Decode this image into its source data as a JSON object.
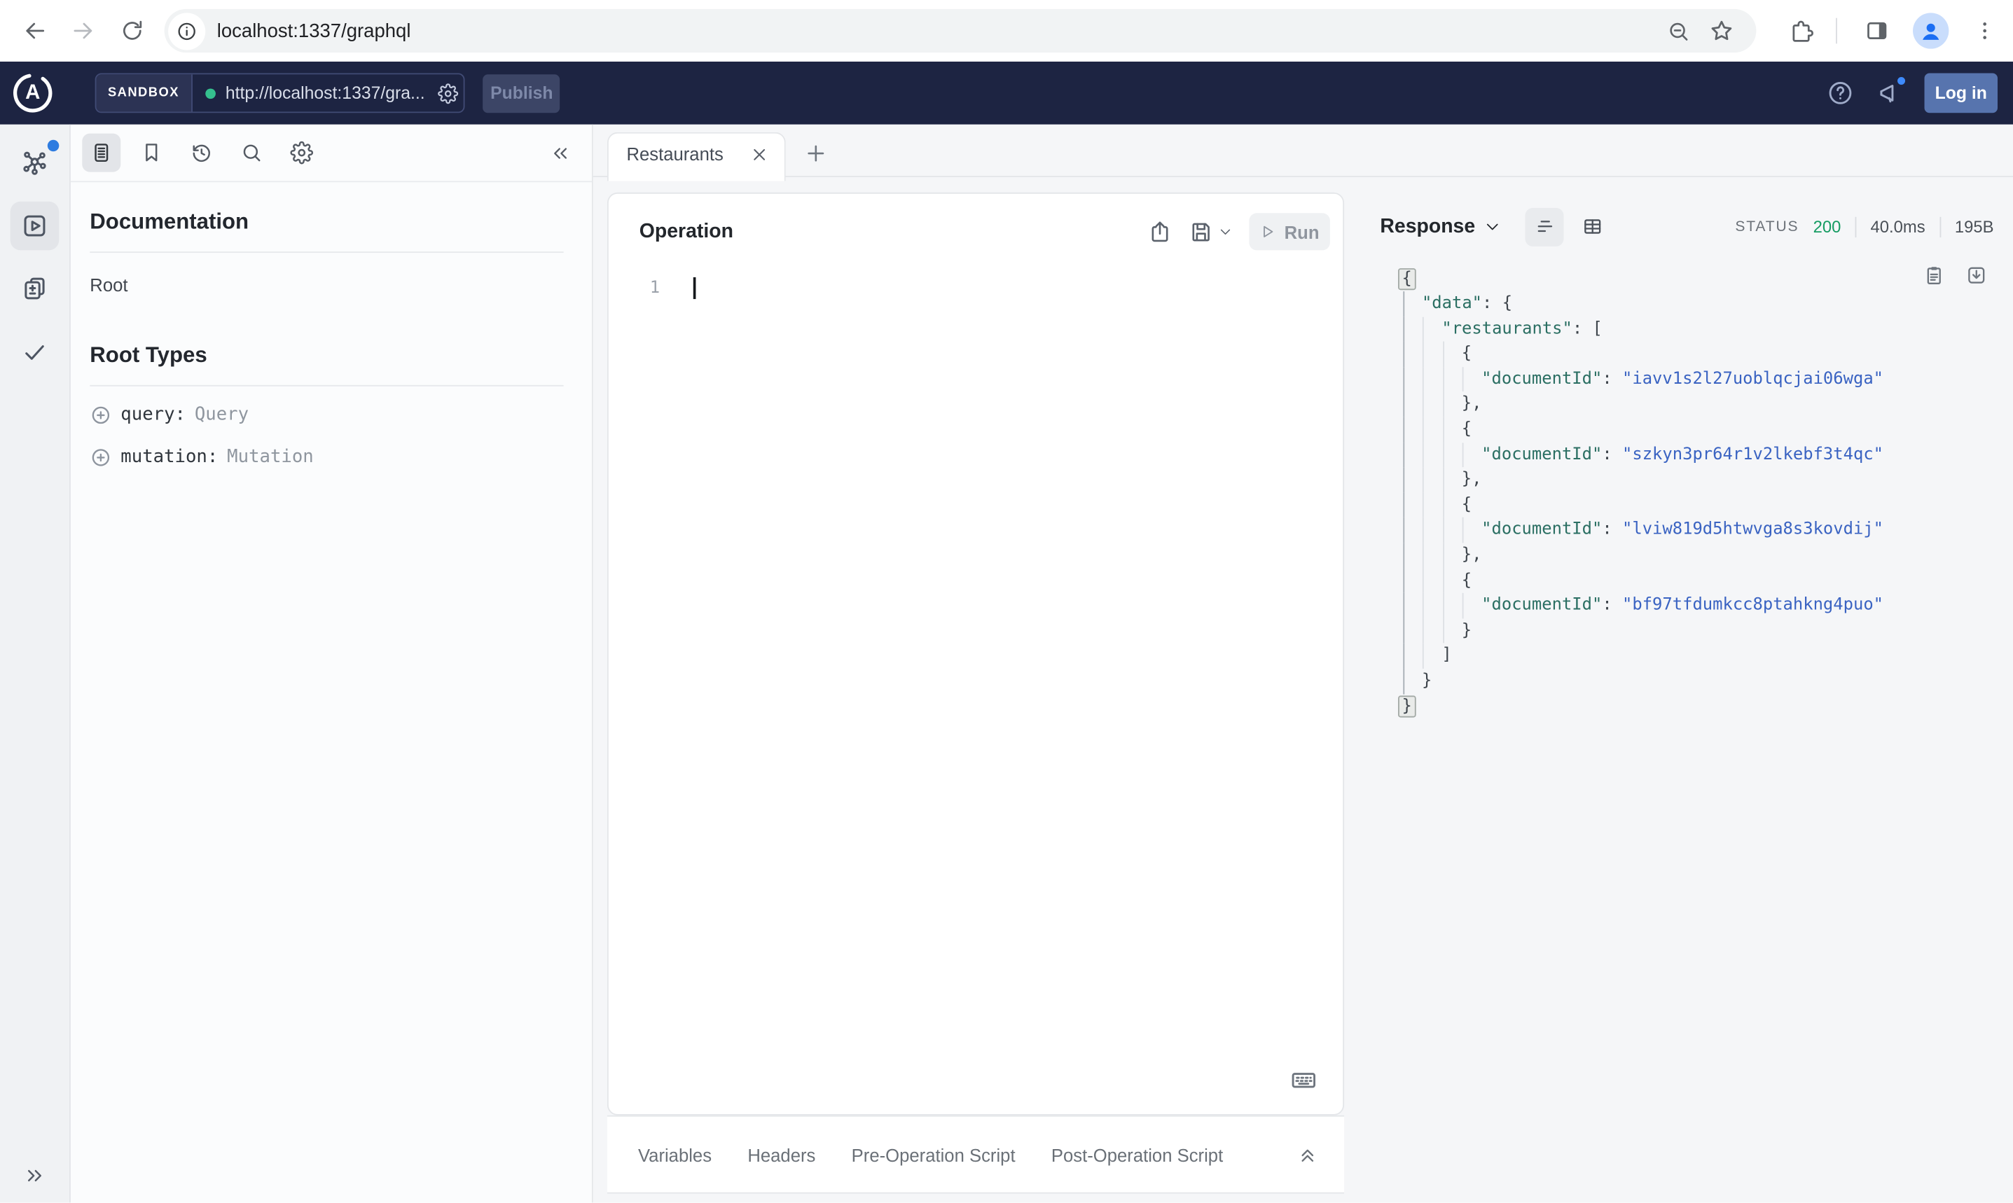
{
  "browser": {
    "url": "localhost:1337/graphql"
  },
  "header": {
    "brand_letter": "A",
    "env_label": "SANDBOX",
    "endpoint": "http://localhost:1337/gra...",
    "publish": "Publish",
    "login": "Log in"
  },
  "docs": {
    "title": "Documentation",
    "root": "Root",
    "root_types": "Root Types",
    "types": [
      {
        "field": "query:",
        "type": "Query"
      },
      {
        "field": "mutation:",
        "type": "Mutation"
      }
    ]
  },
  "tab": {
    "title": "Restaurants"
  },
  "operation": {
    "title": "Operation",
    "run": "Run",
    "line_no": "1"
  },
  "bottom_tabs": [
    "Variables",
    "Headers",
    "Pre-Operation Script",
    "Post-Operation Script"
  ],
  "response": {
    "title": "Response",
    "status_label": "STATUS",
    "status_code": "200",
    "duration": "40.0ms",
    "size": "195B",
    "lines": [
      {
        "indent": 0,
        "seg": [
          {
            "t": "p",
            "x": "{",
            "box": true
          }
        ]
      },
      {
        "indent": 1,
        "seg": [
          {
            "t": "k",
            "x": "\"data\""
          },
          {
            "t": "p",
            "x": ": {"
          }
        ]
      },
      {
        "indent": 2,
        "seg": [
          {
            "t": "k",
            "x": "\"restaurants\""
          },
          {
            "t": "p",
            "x": ": ["
          }
        ]
      },
      {
        "indent": 3,
        "seg": [
          {
            "t": "p",
            "x": "{"
          }
        ]
      },
      {
        "indent": 4,
        "seg": [
          {
            "t": "k",
            "x": "\"documentId\""
          },
          {
            "t": "p",
            "x": ": "
          },
          {
            "t": "s",
            "x": "\"iavv1s2l27uoblqcjai06wga\""
          }
        ]
      },
      {
        "indent": 3,
        "seg": [
          {
            "t": "p",
            "x": "},"
          }
        ]
      },
      {
        "indent": 3,
        "seg": [
          {
            "t": "p",
            "x": "{"
          }
        ]
      },
      {
        "indent": 4,
        "seg": [
          {
            "t": "k",
            "x": "\"documentId\""
          },
          {
            "t": "p",
            "x": ": "
          },
          {
            "t": "s",
            "x": "\"szkyn3pr64r1v2lkebf3t4qc\""
          }
        ]
      },
      {
        "indent": 3,
        "seg": [
          {
            "t": "p",
            "x": "},"
          }
        ]
      },
      {
        "indent": 3,
        "seg": [
          {
            "t": "p",
            "x": "{"
          }
        ]
      },
      {
        "indent": 4,
        "seg": [
          {
            "t": "k",
            "x": "\"documentId\""
          },
          {
            "t": "p",
            "x": ": "
          },
          {
            "t": "s",
            "x": "\"lviw819d5htwvga8s3kovdij\""
          }
        ]
      },
      {
        "indent": 3,
        "seg": [
          {
            "t": "p",
            "x": "},"
          }
        ]
      },
      {
        "indent": 3,
        "seg": [
          {
            "t": "p",
            "x": "{"
          }
        ]
      },
      {
        "indent": 4,
        "seg": [
          {
            "t": "k",
            "x": "\"documentId\""
          },
          {
            "t": "p",
            "x": ": "
          },
          {
            "t": "s",
            "x": "\"bf97tfdumkcc8ptahkng4puo\""
          }
        ]
      },
      {
        "indent": 3,
        "seg": [
          {
            "t": "p",
            "x": "}"
          }
        ]
      },
      {
        "indent": 2,
        "seg": [
          {
            "t": "p",
            "x": "]"
          }
        ]
      },
      {
        "indent": 1,
        "seg": [
          {
            "t": "p",
            "x": "}"
          }
        ]
      },
      {
        "indent": 0,
        "seg": [
          {
            "t": "p",
            "x": "}",
            "box": true
          }
        ]
      }
    ]
  },
  "colors": {
    "header_bg": "#1d2442",
    "accent_blue": "#3e8bfd",
    "status_green": "#169c63",
    "key_color": "#2b6f63",
    "string_color": "#3a63c2"
  }
}
